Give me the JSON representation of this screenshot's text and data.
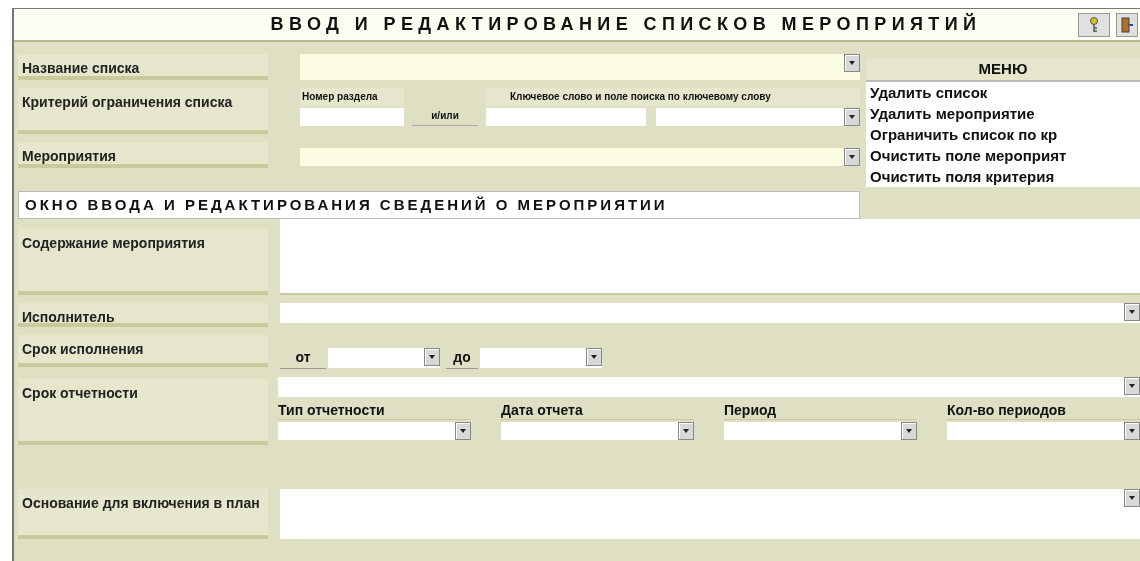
{
  "title": "ВВОД И РЕДАКТИРОВАНИЕ СПИСКОВ МЕРОПРИЯТИЙ",
  "list_form": {
    "list_name": {
      "label": "Название списка"
    },
    "criteria": {
      "label": "Критерий ограничения списка",
      "section_number_label": "Номер раздела",
      "or_label": "и/или",
      "keyword_label": "Ключевое слово и поле поиска по ключевому слову"
    },
    "events": {
      "label": "Мероприятия"
    }
  },
  "menu": {
    "title": "МЕНЮ",
    "items": [
      "Удалить список",
      "Удалить мероприятие",
      "Ограничить список по кр",
      "Очистить поле мероприят",
      "Очистить поля критерия"
    ]
  },
  "event_form": {
    "title": "ОКНО ВВОДА И РЕДАКТИРОВАНИЯ СВЕДЕНИЙ О МЕРОПРИЯТИИ",
    "fields": [
      {
        "kind": "textarea",
        "label": "Содержание мероприятия"
      },
      {
        "kind": "select",
        "label": "Исполнитель"
      },
      {
        "kind": "range",
        "label": "Срок исполнения",
        "from_label": "от",
        "to_label": "до"
      },
      {
        "kind": "reporting",
        "label": "Срок отчетности",
        "columns": [
          "Тип отчетности",
          "Дата отчета",
          "Период",
          "Кол-во периодов"
        ]
      },
      {
        "kind": "memo",
        "label": "Основание для включения в план"
      }
    ]
  }
}
